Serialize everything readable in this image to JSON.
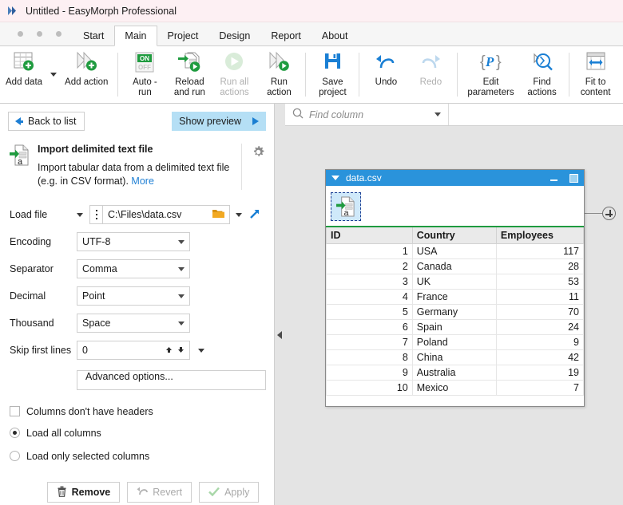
{
  "window": {
    "title": "Untitled - EasyMorph Professional",
    "logo_icon": "easymorph-logo-icon"
  },
  "tabs": [
    {
      "label": "Start",
      "active": false
    },
    {
      "label": "Main",
      "active": true
    },
    {
      "label": "Project",
      "active": false
    },
    {
      "label": "Design",
      "active": false
    },
    {
      "label": "Report",
      "active": false
    },
    {
      "label": "About",
      "active": false
    }
  ],
  "ribbon": {
    "buttons": [
      {
        "label": "Add data",
        "icon": "table-plus-icon",
        "disabled": false,
        "has_caret": true
      },
      {
        "label": "Add action",
        "icon": "action-plus-icon",
        "disabled": false,
        "has_caret": false
      },
      {
        "label": "Auto -\nrun",
        "icon": "onoff-toggle-icon",
        "disabled": false,
        "has_caret": false
      },
      {
        "label": "Reload\nand run",
        "icon": "reload-run-icon",
        "disabled": false,
        "has_caret": false
      },
      {
        "label": "Run all\nactions",
        "icon": "run-all-icon",
        "disabled": true,
        "has_caret": false
      },
      {
        "label": "Run\naction",
        "icon": "run-action-icon",
        "disabled": false,
        "has_caret": false
      },
      {
        "label": "Save\nproject",
        "icon": "floppy-save-icon",
        "disabled": false,
        "has_caret": false
      },
      {
        "label": "Undo",
        "icon": "undo-arrow-icon",
        "disabled": false,
        "has_caret": false
      },
      {
        "label": "Redo",
        "icon": "redo-arrow-icon",
        "disabled": true,
        "has_caret": false
      },
      {
        "label": "Edit\nparameters",
        "icon": "parameters-p-icon",
        "disabled": false,
        "has_caret": false
      },
      {
        "label": "Find\nactions",
        "icon": "find-actions-magnifier-icon",
        "disabled": false,
        "has_caret": false
      },
      {
        "label": "Fit to\ncontent",
        "icon": "fit-to-content-icon",
        "disabled": false,
        "has_caret": false
      }
    ],
    "autorun": {
      "on_label": "ON",
      "off_label": "OFF",
      "on_color": "#1f9b3f"
    }
  },
  "left_panel": {
    "back_button": "Back to list",
    "show_preview": "Show preview",
    "action": {
      "icon": "import-text-file-icon",
      "title": "Import delimited text file",
      "description": "Import tabular data from a delimited text file (e.g. in CSV format).",
      "more_link": "More",
      "gear_icon": "gear-icon"
    },
    "fields": [
      {
        "label": "Load file",
        "value": "C:\\Files\\data.csv",
        "type": "file"
      },
      {
        "label": "Encoding",
        "value": "UTF-8",
        "type": "select"
      },
      {
        "label": "Separator",
        "value": "Comma",
        "type": "select"
      },
      {
        "label": "Decimal",
        "value": "Point",
        "type": "select"
      },
      {
        "label": "Thousand",
        "value": "Space",
        "type": "select"
      },
      {
        "label": "Skip first lines",
        "value": "0",
        "type": "spinner"
      }
    ],
    "advanced_button": "Advanced options...",
    "checkbox": {
      "label": "Columns don't have headers",
      "checked": false
    },
    "radios": [
      {
        "label": "Load all columns",
        "selected": true
      },
      {
        "label": "Load only selected columns",
        "selected": false
      }
    ],
    "action_buttons": [
      {
        "label": "Remove",
        "icon": "trash-icon",
        "disabled": false
      },
      {
        "label": "Revert",
        "icon": "revert-arrow-icon",
        "disabled": true
      },
      {
        "label": "Apply",
        "icon": "check-icon",
        "disabled": true
      }
    ]
  },
  "find_bar": {
    "placeholder": "Find column",
    "search_icon": "search-icon",
    "caret_icon": "chevron-down-icon"
  },
  "data_window": {
    "title": "data.csv",
    "collapse_icon": "triangle-down-icon",
    "minimize_icon": "minimize-icon",
    "maximize_icon": "maximize-icon",
    "node_icon": "import-text-file-icon",
    "accent_color": "#2a93db",
    "header_accent": "#1f9b3f",
    "columns": [
      "ID",
      "Country",
      "Employees"
    ],
    "rows": [
      [
        "1",
        "USA",
        "117"
      ],
      [
        "2",
        "Canada",
        "28"
      ],
      [
        "3",
        "UK",
        "53"
      ],
      [
        "4",
        "France",
        "11"
      ],
      [
        "5",
        "Germany",
        "70"
      ],
      [
        "6",
        "Spain",
        "24"
      ],
      [
        "7",
        "Poland",
        "9"
      ],
      [
        "8",
        "China",
        "42"
      ],
      [
        "9",
        "Australia",
        "19"
      ],
      [
        "10",
        "Mexico",
        "7"
      ]
    ]
  },
  "canvas": {
    "add_node_icon": "plus-circle-icon"
  }
}
